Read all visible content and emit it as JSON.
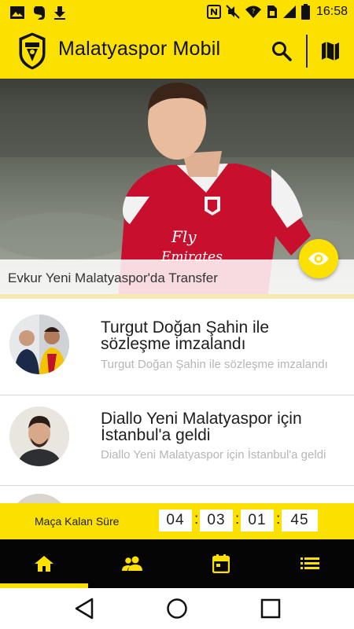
{
  "status_bar": {
    "time": "16:58",
    "left_icons": [
      "image-icon",
      "evernote-icon",
      "download-icon"
    ],
    "right_icons": [
      "nfc-icon",
      "mute-icon",
      "wifi-icon",
      "sim-icon",
      "signal-icon",
      "battery-icon"
    ]
  },
  "app_bar": {
    "title": "Malatyaspor Mobil",
    "logo_icon": "club-crest-icon",
    "actions": [
      "search-icon",
      "map-icon"
    ],
    "background": "#fbe000"
  },
  "hero": {
    "caption": "Evkur Yeni Malatyaspor'da Transfer",
    "fab_icon": "eye-icon",
    "jersey_text": "Fly Emirates"
  },
  "news": [
    {
      "title": "Turgut Doğan Şahin ile sözleşme imzalandı",
      "subtitle": "Turgut Doğan Şahin ile sözleşme imzalandı"
    },
    {
      "title": "Diallo Yeni Malatyaspor için İstanbul'a geldi",
      "subtitle": "Diallo Yeni Malatyaspor için İstanbul'a geldi"
    }
  ],
  "countdown": {
    "label": "Maça Kalan Süre",
    "days": "04",
    "hours": "03",
    "minutes": "01",
    "seconds": "45"
  },
  "bottom_nav": {
    "tabs": [
      "home-icon",
      "people-icon",
      "calendar-icon",
      "list-icon"
    ],
    "selected_index": 0
  },
  "system_nav": [
    "back-icon",
    "home-circle-icon",
    "recents-icon"
  ],
  "colors": {
    "accent": "#fbe000",
    "nav_bg": "#050505",
    "subtitle": "#b6b6b6"
  }
}
